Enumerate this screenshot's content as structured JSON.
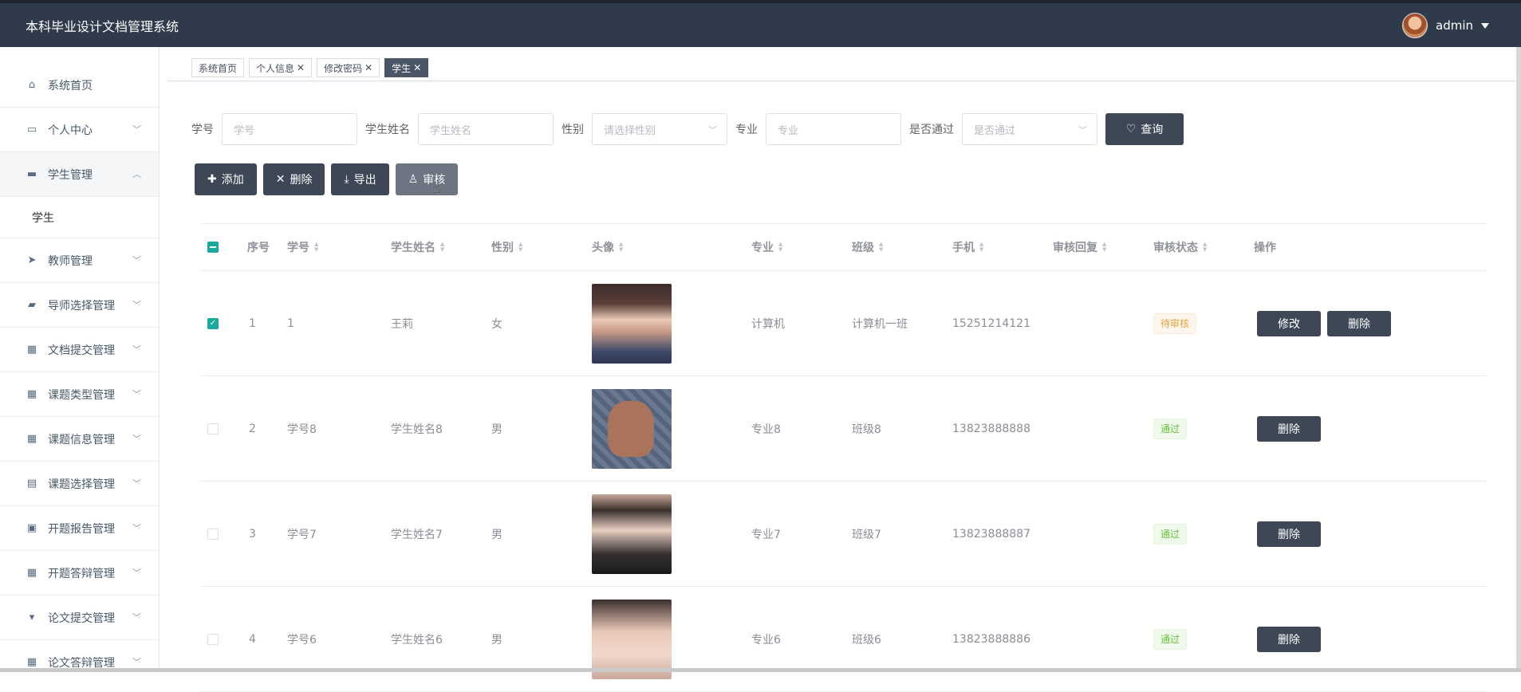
{
  "app": {
    "title": "本科毕业设计文档管理系统",
    "user": "admin"
  },
  "sidebar": {
    "items": [
      {
        "label": "系统首页",
        "icon": "home-icon",
        "chevron": false
      },
      {
        "label": "个人中心",
        "icon": "card-icon",
        "chevron": true
      },
      {
        "label": "学生管理",
        "icon": "monitor-icon",
        "chevron": true,
        "open": true
      },
      {
        "label": "教师管理",
        "icon": "send-icon",
        "chevron": true
      },
      {
        "label": "导师选择管理",
        "icon": "ticket-icon",
        "chevron": true
      },
      {
        "label": "文档提交管理",
        "icon": "grid-icon",
        "chevron": true
      },
      {
        "label": "课题类型管理",
        "icon": "apps-icon",
        "chevron": true
      },
      {
        "label": "课题信息管理",
        "icon": "grid-icon",
        "chevron": true
      },
      {
        "label": "课题选择管理",
        "icon": "clipboard-icon",
        "chevron": true
      },
      {
        "label": "开题报告管理",
        "icon": "wallet-icon",
        "chevron": true
      },
      {
        "label": "开题答辩管理",
        "icon": "grid-icon",
        "chevron": true
      },
      {
        "label": "论文提交管理",
        "icon": "podium-icon",
        "chevron": true
      },
      {
        "label": "论文答辩管理",
        "icon": "grid-icon",
        "chevron": true
      }
    ],
    "sub_item": "学生"
  },
  "tabs": [
    {
      "label": "系统首页",
      "closable": false
    },
    {
      "label": "个人信息",
      "closable": true
    },
    {
      "label": "修改密码",
      "closable": true
    },
    {
      "label": "学生",
      "closable": true,
      "active": true
    }
  ],
  "filters": {
    "student_no": {
      "label": "学号",
      "placeholder": "学号"
    },
    "student_name": {
      "label": "学生姓名",
      "placeholder": "学生姓名"
    },
    "gender": {
      "label": "性别",
      "placeholder": "请选择性别"
    },
    "major": {
      "label": "专业",
      "placeholder": "专业"
    },
    "passed": {
      "label": "是否通过",
      "placeholder": "是否通过"
    },
    "query_button": "查询"
  },
  "actions": {
    "add": "添加",
    "delete": "删除",
    "export": "导出",
    "review": "审核"
  },
  "table": {
    "columns": [
      "序号",
      "学号",
      "学生姓名",
      "性别",
      "头像",
      "专业",
      "班级",
      "手机",
      "审核回复",
      "审核状态",
      "操作"
    ],
    "rows": [
      {
        "index": "1",
        "no": "1",
        "name": "王莉",
        "gender": "女",
        "major": "计算机",
        "class": "计算机一班",
        "phone": "15251214121",
        "reply": "",
        "status": "待审核",
        "status_type": "wait",
        "checked": true,
        "ops": [
          "修改",
          "删除"
        ]
      },
      {
        "index": "2",
        "no": "学号8",
        "name": "学生姓名8",
        "gender": "男",
        "major": "专业8",
        "class": "班级8",
        "phone": "13823888888",
        "reply": "",
        "status": "通过",
        "status_type": "pass",
        "checked": false,
        "ops": [
          "删除"
        ]
      },
      {
        "index": "3",
        "no": "学号7",
        "name": "学生姓名7",
        "gender": "男",
        "major": "专业7",
        "class": "班级7",
        "phone": "13823888887",
        "reply": "",
        "status": "通过",
        "status_type": "pass",
        "checked": false,
        "ops": [
          "删除"
        ]
      },
      {
        "index": "4",
        "no": "学号6",
        "name": "学生姓名6",
        "gender": "男",
        "major": "专业6",
        "class": "班级6",
        "phone": "13823888886",
        "reply": "",
        "status": "通过",
        "status_type": "pass",
        "checked": false,
        "ops": [
          "删除"
        ]
      }
    ]
  },
  "colors": {
    "topbar": "#2f3a4a",
    "button": "#3d4756",
    "checkbox": "#1aa99c",
    "pending": "#e6a23c",
    "pass": "#67c23a"
  }
}
